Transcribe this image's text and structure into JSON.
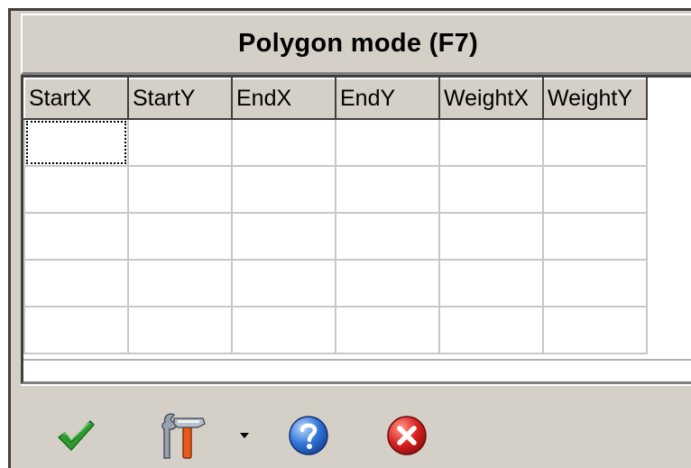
{
  "window": {
    "title": "Polygon mode (F7)"
  },
  "grid": {
    "columns": [
      "StartX",
      "StartY",
      "EndX",
      "EndY",
      "WeightX",
      "WeightY"
    ],
    "rows": [
      [
        "",
        "",
        "",
        "",
        "",
        ""
      ],
      [
        "",
        "",
        "",
        "",
        "",
        ""
      ],
      [
        "",
        "",
        "",
        "",
        "",
        ""
      ],
      [
        "",
        "",
        "",
        "",
        "",
        ""
      ],
      [
        "",
        "",
        "",
        "",
        "",
        ""
      ]
    ],
    "focused_cell": "row 1, StartX"
  },
  "toolbar": {
    "buttons": [
      {
        "name": "ok",
        "icon": "checkmark-icon",
        "color": "#2e9b2e"
      },
      {
        "name": "tools",
        "icon": "tools-icon",
        "color": "#e85a1c"
      },
      {
        "name": "help",
        "icon": "help-icon",
        "color": "#2f73d8"
      },
      {
        "name": "cancel",
        "icon": "close-icon",
        "color": "#d8201f"
      }
    ]
  },
  "colors": {
    "face": "#d4d0c8",
    "grid_lines": "#c8c8c8"
  }
}
